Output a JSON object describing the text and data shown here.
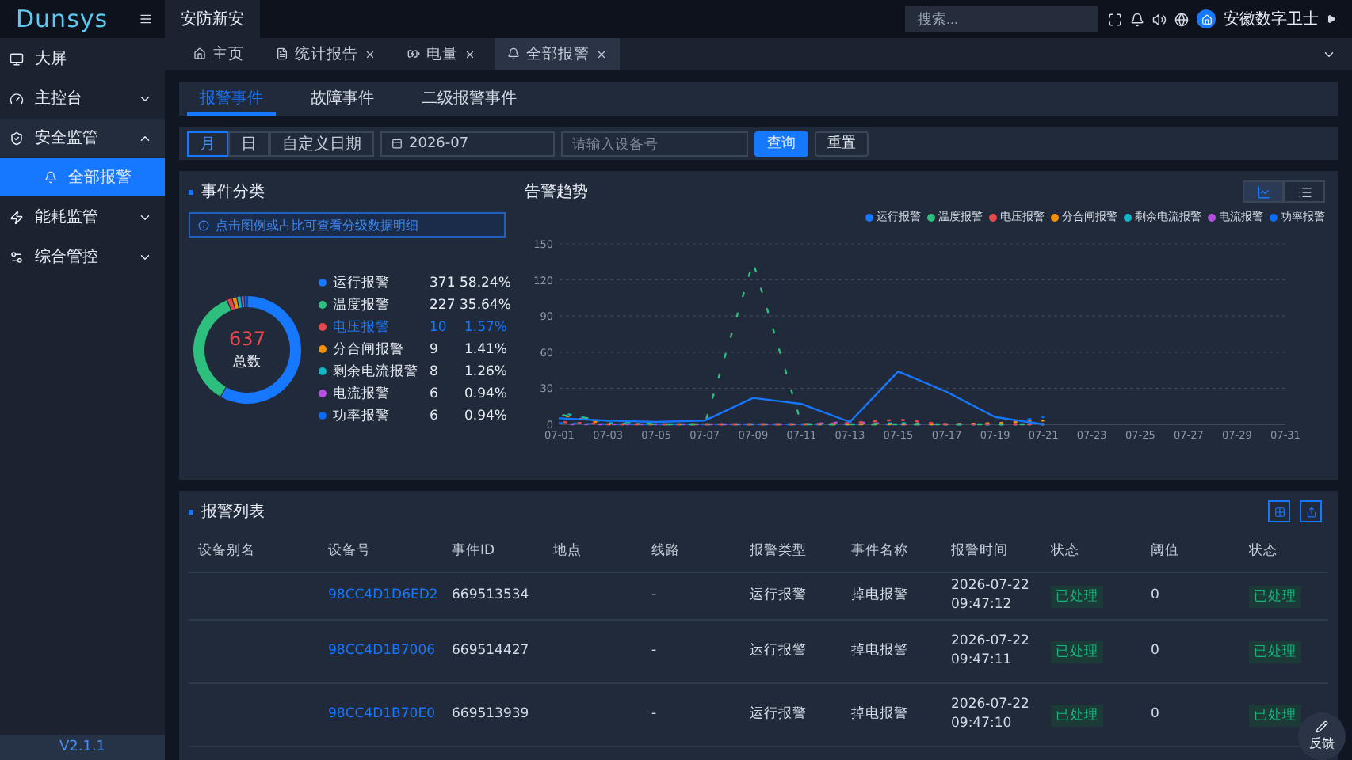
{
  "logo": "Dunsys",
  "top_tab": {
    "label": "安防新安",
    "selected": true
  },
  "search": {
    "placeholder": "搜索..."
  },
  "user": {
    "name": "安徽数字卫士"
  },
  "sidebar": {
    "items": [
      {
        "label": "大屏",
        "selected": false
      },
      {
        "label": "主控台",
        "selected": false,
        "expanded": false
      },
      {
        "label": "安全监管",
        "selected": false,
        "expanded": true,
        "children": [
          {
            "label": "全部报警",
            "selected": true
          }
        ]
      },
      {
        "label": "能耗监管",
        "selected": false,
        "expanded": false
      },
      {
        "label": "综合管控",
        "selected": false,
        "expanded": false
      }
    ],
    "version": "V2.1.1"
  },
  "page_tabs": [
    {
      "label": "主页",
      "selected": false,
      "closable": false
    },
    {
      "label": "统计报告",
      "selected": false,
      "closable": true
    },
    {
      "label": "电量",
      "selected": false,
      "closable": true
    },
    {
      "label": "全部报警",
      "selected": true,
      "closable": true
    }
  ],
  "event_tabs": [
    {
      "label": "报警事件",
      "selected": true
    },
    {
      "label": "故障事件",
      "selected": false
    },
    {
      "label": "二级报警事件",
      "selected": false
    }
  ],
  "filter": {
    "periods": [
      {
        "label": "月",
        "selected": true
      },
      {
        "label": "日",
        "selected": false
      },
      {
        "label": "自定义日期",
        "selected": false
      }
    ],
    "date": "2026-07",
    "device_placeholder": "请输入设备号",
    "query": "查询",
    "reset": "重置"
  },
  "classification": {
    "title": "事件分类",
    "hint": "点击图例或占比可查看分级数据明细",
    "total": "637",
    "total_label": "总数",
    "items": [
      {
        "name": "运行报警",
        "count": "371",
        "percent": "58.24%",
        "color": "#1677ff",
        "selected": false
      },
      {
        "name": "温度报警",
        "count": "227",
        "percent": "35.64%",
        "color": "#2dbf7e",
        "selected": false
      },
      {
        "name": "电压报警",
        "count": "10",
        "percent": "1.57%",
        "color": "#e5484d",
        "selected": true
      },
      {
        "name": "分合闸报警",
        "count": "9",
        "percent": "1.41%",
        "color": "#f0900c",
        "selected": false
      },
      {
        "name": "剩余电流报警",
        "count": "8",
        "percent": "1.26%",
        "color": "#13b5c8",
        "selected": false
      },
      {
        "name": "电流报警",
        "count": "6",
        "percent": "0.94%",
        "color": "#b44fe0",
        "selected": false
      },
      {
        "name": "功率报警",
        "count": "6",
        "percent": "0.94%",
        "color": "#0a6cf5",
        "selected": false
      }
    ]
  },
  "trend": {
    "title": "告警趋势",
    "views": [
      {
        "kind": "chart",
        "selected": true
      },
      {
        "kind": "list",
        "selected": false
      }
    ],
    "chart_data": {
      "type": "line",
      "categories": [
        "07-01",
        "07-03",
        "07-05",
        "07-07",
        "07-09",
        "07-11",
        "07-13",
        "07-15",
        "07-17",
        "07-19",
        "07-21",
        "07-23",
        "07-25",
        "07-27",
        "07-29",
        "07-31"
      ],
      "ylim": [
        0,
        150
      ],
      "grid": true,
      "yticks": [
        0,
        30,
        60,
        90,
        120,
        150
      ],
      "series": [
        {
          "name": "运行报警",
          "color": "#1677ff",
          "line_style": "solid",
          "values": [
            5,
            3,
            2,
            3,
            22,
            17,
            2,
            44,
            27,
            6,
            0,
            null,
            null,
            null,
            null,
            null
          ]
        },
        {
          "name": "温度报警",
          "color": "#2dbf7e",
          "line_style": "dashed",
          "values": [
            8,
            3,
            0,
            0,
            135,
            0,
            0,
            0,
            0,
            0,
            0,
            null,
            null,
            null,
            null,
            null
          ]
        },
        {
          "name": "电压报警",
          "color": "#e5484d",
          "line_style": "dashed",
          "values": [
            2,
            0,
            0,
            0,
            0,
            0,
            1,
            4,
            0,
            0,
            0,
            null,
            null,
            null,
            null,
            null
          ]
        },
        {
          "name": "分合闸报警",
          "color": "#f0900c",
          "line_style": "dashed",
          "values": [
            8,
            0,
            0,
            0,
            0,
            0,
            0,
            0,
            0,
            1,
            3,
            null,
            null,
            null,
            null,
            null
          ]
        },
        {
          "name": "剩余电流报警",
          "color": "#13b5c8",
          "line_style": "dashed",
          "values": [
            10,
            1,
            0,
            0,
            0,
            0,
            0,
            1,
            0,
            0,
            0,
            null,
            null,
            null,
            null,
            null
          ]
        },
        {
          "name": "电流报警",
          "color": "#b44fe0",
          "line_style": "dashed",
          "values": [
            0,
            0,
            0,
            0,
            0,
            0,
            2,
            0,
            0,
            0,
            0,
            null,
            null,
            null,
            null,
            null
          ]
        },
        {
          "name": "功率报警",
          "color": "#0a6cf5",
          "line_style": "dashed",
          "values": [
            1,
            0,
            0,
            0,
            0,
            0,
            0,
            0,
            0,
            0,
            6,
            null,
            null,
            null,
            null,
            null
          ]
        }
      ]
    }
  },
  "alarm_list": {
    "title": "报警列表",
    "columns": [
      "设备别名",
      "设备号",
      "事件ID",
      "地点",
      "线路",
      "报警类型",
      "事件名称",
      "报警时间",
      "状态",
      "阈值",
      "状态"
    ],
    "rows": [
      {
        "device_no": "98CC4D1D6ED2",
        "event_id": "669513534",
        "line": "-",
        "type": "运行报警",
        "event": "掉电报警",
        "date": "2026-07-22",
        "time": "09:47:12",
        "status": "已处理",
        "threshold": "0",
        "status_2": "已处理"
      },
      {
        "device_no": "98CC4D1B7006",
        "event_id": "669514427",
        "line": "-",
        "type": "运行报警",
        "event": "掉电报警",
        "date": "2026-07-22",
        "time": "09:47:11",
        "status": "已处理",
        "threshold": "0",
        "status_2": "已处理"
      },
      {
        "device_no": "98CC4D1B70E0",
        "event_id": "669513939",
        "line": "-",
        "type": "运行报警",
        "event": "掉电报警",
        "date": "2026-07-22",
        "time": "09:47:10",
        "status": "已处理",
        "threshold": "0",
        "status_2": "已处理"
      }
    ]
  },
  "feedback": "反馈"
}
